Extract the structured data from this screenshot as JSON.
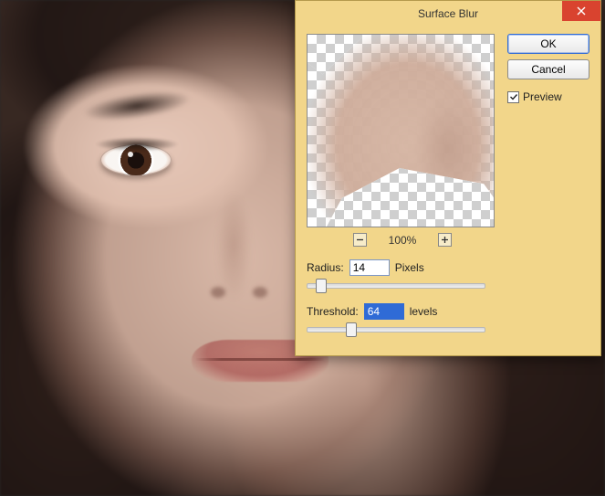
{
  "dialog": {
    "title": "Surface Blur",
    "ok_label": "OK",
    "cancel_label": "Cancel",
    "preview_label": "Preview",
    "preview_checked": true,
    "zoom_percent": "100%",
    "radius_label": "Radius:",
    "radius_value": "14",
    "radius_unit": "Pixels",
    "threshold_label": "Threshold:",
    "threshold_value": "64",
    "threshold_unit": "levels",
    "radius_thumb_pct": 8,
    "threshold_thumb_pct": 25,
    "colors": {
      "accent": "#2f6bd6",
      "dialog_bg": "#f2d68a",
      "close_bg": "#d9432f"
    }
  }
}
